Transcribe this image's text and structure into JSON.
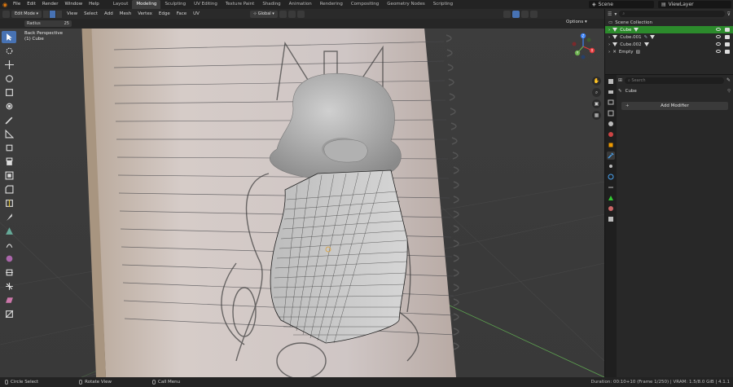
{
  "app": {
    "menus": [
      "File",
      "Edit",
      "Render",
      "Window",
      "Help"
    ],
    "workspaces": [
      "Layout",
      "Modeling",
      "Sculpting",
      "UV Editing",
      "Texture Paint",
      "Shading",
      "Animation",
      "Rendering",
      "Compositing",
      "Geometry Nodes",
      "Scripting"
    ],
    "active_workspace": "Modeling",
    "scene": "Scene",
    "view_layer": "ViewLayer"
  },
  "viewport_header": {
    "mode": "Edit Mode",
    "menus": [
      "View",
      "Select",
      "Add",
      "Mesh",
      "Vertex",
      "Edge",
      "Face",
      "UV"
    ],
    "transform_orientation": "Global",
    "options": "Options"
  },
  "tool_settings": {
    "radius_label": "Radius",
    "radius_value": "25"
  },
  "viewport_info": {
    "view_name": "Back Perspective",
    "object_line": "(1) Cube"
  },
  "gizmo": {
    "axes": [
      "X",
      "Y",
      "Z"
    ],
    "colors": {
      "x": "#e5383b",
      "y": "#6ab04c",
      "z": "#3b82f6"
    }
  },
  "outliner": {
    "search_placeholder": "",
    "root": "Scene Collection",
    "items": [
      {
        "name": "Cube",
        "selected": true
      },
      {
        "name": "Cube.001",
        "selected": false
      },
      {
        "name": "Cube.002",
        "selected": false
      },
      {
        "name": "Empty",
        "selected": false
      }
    ]
  },
  "properties": {
    "search_placeholder": "Search",
    "object_name": "Cube",
    "add_modifier": "Add Modifier"
  },
  "statusbar": {
    "left": [
      {
        "label": "Circle Select"
      },
      {
        "label": "Rotate View"
      },
      {
        "label": "Call Menu"
      }
    ],
    "right": "Duration: 00:10+10 (Frame 1/250) | VRAM: 1.5/8.0 GiB | 4.1.1"
  },
  "colors": {
    "accent_blue": "#4772b3",
    "selected_green": "#2c8b2c",
    "blender_orange": "#e87d0d"
  }
}
